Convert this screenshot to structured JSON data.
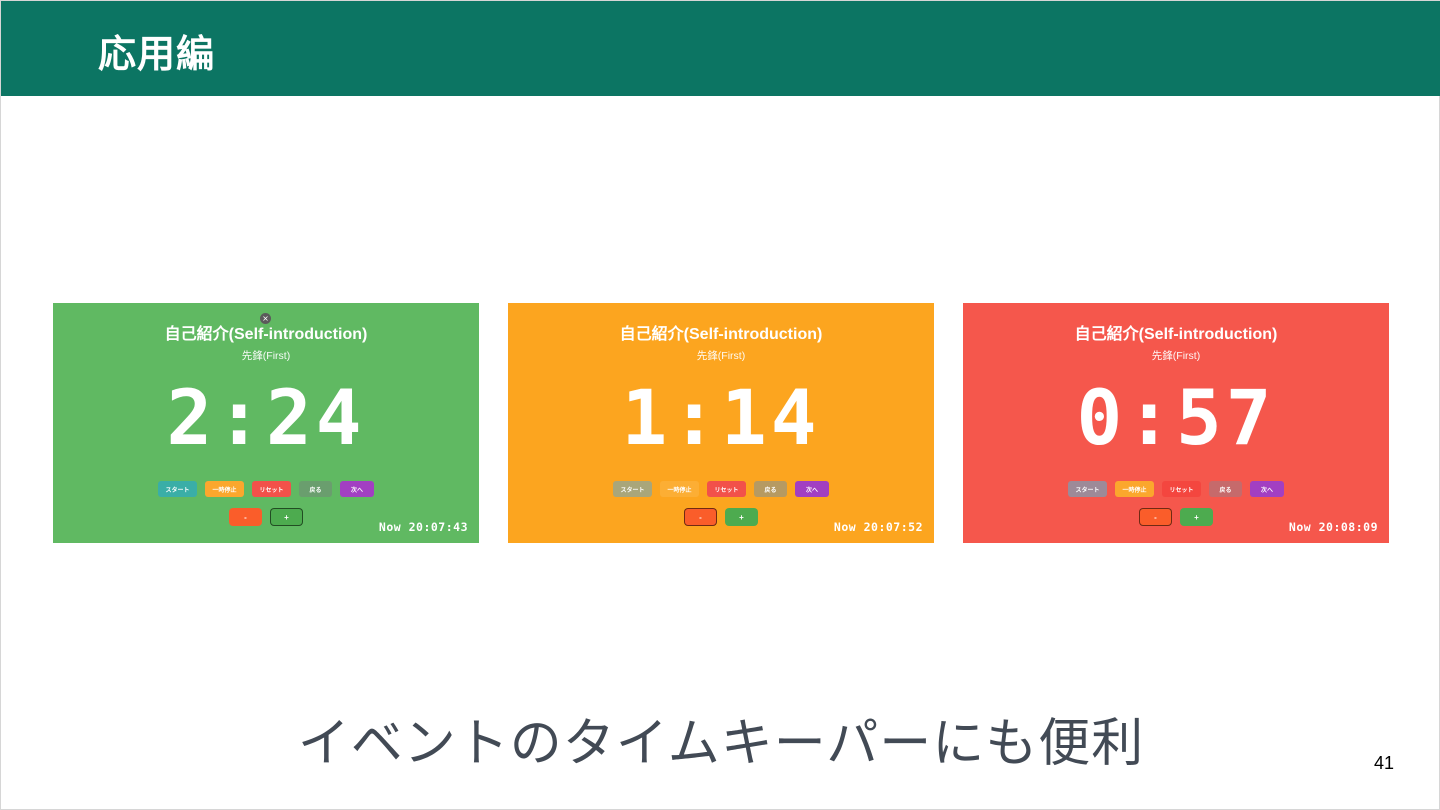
{
  "slide": {
    "title": "応用編",
    "caption": "イベントのタイムキーパーにも便利",
    "page_number": "41"
  },
  "panels": [
    {
      "bg": "#60b962",
      "title": "自己紹介(Self-introduction)",
      "subtitle": "先鋒(First)",
      "timer": "2:24",
      "now": "Now 20:07:43",
      "buttons": {
        "start": "スタート",
        "pause": "一時停止",
        "reset": "リセット",
        "back": "戻る",
        "next": "次へ",
        "minus": "-",
        "plus": "+"
      },
      "button_colors": {
        "start": "#3aaea7",
        "pause": "#fba72d",
        "reset": "#f2514a",
        "back": "#6a9e6e",
        "next": "#a23fc2",
        "minus": "#fa5d2a",
        "plus": "#4dab4f"
      }
    },
    {
      "bg": "#fca51f",
      "title": "自己紹介(Self-introduction)",
      "subtitle": "先鋒(First)",
      "timer": "1:14",
      "now": "Now 20:07:52",
      "buttons": {
        "start": "スタート",
        "pause": "一時停止",
        "reset": "リセット",
        "back": "戻る",
        "next": "次へ",
        "minus": "-",
        "plus": "+"
      },
      "button_colors": {
        "start": "#a9a67a",
        "pause": "#fcae34",
        "reset": "#f2514a",
        "back": "#b69a62",
        "next": "#a23fc2",
        "minus": "#fa5d2a",
        "plus": "#4dab4f"
      }
    },
    {
      "bg": "#f5574c",
      "title": "自己紹介(Self-introduction)",
      "subtitle": "先鋒(First)",
      "timer": "0:57",
      "now": "Now 20:08:09",
      "buttons": {
        "start": "スタート",
        "pause": "一時停止",
        "reset": "リセット",
        "back": "戻る",
        "next": "次へ",
        "minus": "-",
        "plus": "+"
      },
      "button_colors": {
        "start": "#9d8a98",
        "pause": "#fba72d",
        "reset": "#f4463f",
        "back": "#c66a6b",
        "next": "#a23fc2",
        "minus": "#fa5d2a",
        "plus": "#4dab4f"
      }
    }
  ]
}
